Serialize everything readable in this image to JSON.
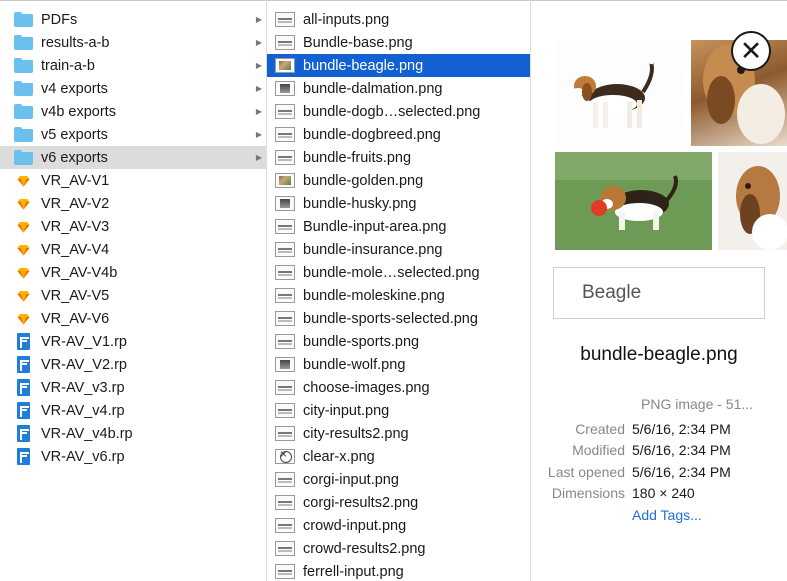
{
  "column1": {
    "items": [
      {
        "name": "PDFs",
        "kind": "folder"
      },
      {
        "name": "results-a-b",
        "kind": "folder"
      },
      {
        "name": "train-a-b",
        "kind": "folder"
      },
      {
        "name": "v4 exports",
        "kind": "folder"
      },
      {
        "name": "v4b exports",
        "kind": "folder"
      },
      {
        "name": "v5 exports",
        "kind": "folder"
      },
      {
        "name": "v6 exports",
        "kind": "folder",
        "selected": true
      },
      {
        "name": "VR_AV-V1",
        "kind": "sketch"
      },
      {
        "name": "VR_AV-V2",
        "kind": "sketch"
      },
      {
        "name": "VR_AV-V3",
        "kind": "sketch"
      },
      {
        "name": "VR_AV-V4",
        "kind": "sketch"
      },
      {
        "name": "VR_AV-V4b",
        "kind": "sketch"
      },
      {
        "name": "VR_AV-V5",
        "kind": "sketch"
      },
      {
        "name": "VR_AV-V6",
        "kind": "sketch"
      },
      {
        "name": "VR-AV_V1.rp",
        "kind": "rp"
      },
      {
        "name": "VR-AV_V2.rp",
        "kind": "rp"
      },
      {
        "name": "VR-AV_v3.rp",
        "kind": "rp"
      },
      {
        "name": "VR-AV_v4.rp",
        "kind": "rp"
      },
      {
        "name": "VR-AV_v4b.rp",
        "kind": "rp"
      },
      {
        "name": "VR-AV_v6.rp",
        "kind": "rp"
      }
    ]
  },
  "column2": {
    "items": [
      {
        "name": "all-inputs.png",
        "thumb": "strip"
      },
      {
        "name": "Bundle-base.png",
        "thumb": "strip"
      },
      {
        "name": "bundle-beagle.png",
        "thumb": "pic",
        "selected": true
      },
      {
        "name": "bundle-dalmation.png",
        "thumb": "bw"
      },
      {
        "name": "bundle-dogb…selected.png",
        "thumb": "strip"
      },
      {
        "name": "bundle-dogbreed.png",
        "thumb": "strip"
      },
      {
        "name": "bundle-fruits.png",
        "thumb": "strip"
      },
      {
        "name": "bundle-golden.png",
        "thumb": "pic"
      },
      {
        "name": "bundle-husky.png",
        "thumb": "bw"
      },
      {
        "name": "Bundle-input-area.png",
        "thumb": "strip"
      },
      {
        "name": "bundle-insurance.png",
        "thumb": "strip"
      },
      {
        "name": "bundle-mole…selected.png",
        "thumb": "strip"
      },
      {
        "name": "bundle-moleskine.png",
        "thumb": "strip"
      },
      {
        "name": "bundle-sports-selected.png",
        "thumb": "strip"
      },
      {
        "name": "bundle-sports.png",
        "thumb": "strip"
      },
      {
        "name": "bundle-wolf.png",
        "thumb": "bw"
      },
      {
        "name": "choose-images.png",
        "thumb": "strip"
      },
      {
        "name": "city-input.png",
        "thumb": "strip"
      },
      {
        "name": "city-results2.png",
        "thumb": "strip"
      },
      {
        "name": "clear-x.png",
        "thumb": "xcirc"
      },
      {
        "name": "corgi-input.png",
        "thumb": "strip"
      },
      {
        "name": "corgi-results2.png",
        "thumb": "strip"
      },
      {
        "name": "crowd-input.png",
        "thumb": "strip"
      },
      {
        "name": "crowd-results2.png",
        "thumb": "strip"
      },
      {
        "name": "ferrell-input.png",
        "thumb": "strip"
      }
    ]
  },
  "preview": {
    "search_text": "Beagle",
    "file_name": "bundle-beagle.png",
    "kind": "PNG image - 51...",
    "info": [
      {
        "label": "Created",
        "value": "5/6/16, 2:34 PM"
      },
      {
        "label": "Modified",
        "value": "5/6/16, 2:34 PM"
      },
      {
        "label": "Last opened",
        "value": "5/6/16, 2:34 PM"
      },
      {
        "label": "Dimensions",
        "value": "180 × 240"
      }
    ],
    "add_tags_label": "Add Tags..."
  },
  "colors": {
    "selection_blue": "#1360d2",
    "selection_grey": "#dcdcdc",
    "folder_blue": "#6cc0ee",
    "link_blue": "#1f6fd8"
  }
}
